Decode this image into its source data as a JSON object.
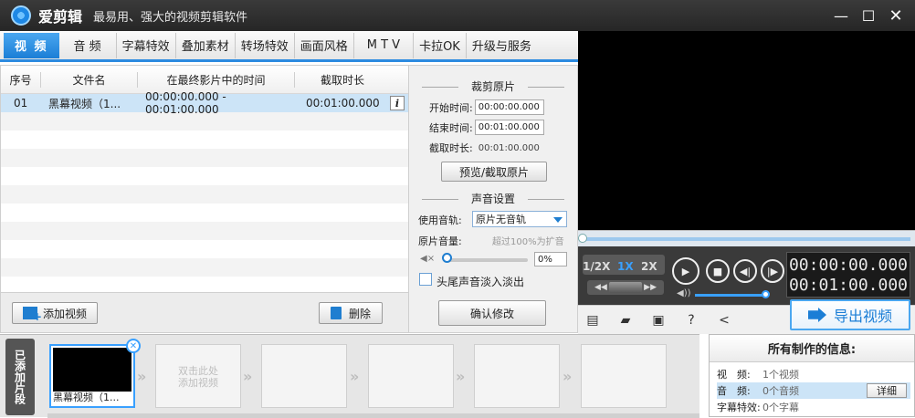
{
  "app": {
    "title": "爱剪辑",
    "subtitle": "最易用、强大的视频剪辑软件"
  },
  "window": {
    "minimize": "—",
    "maximize": "☐",
    "close": "✕"
  },
  "tabs": [
    "视 频",
    "音 频",
    "字幕特效",
    "叠加素材",
    "转场特效",
    "画面风格",
    "M T V",
    "卡拉OK",
    "升级与服务"
  ],
  "video_list": {
    "columns": [
      "序号",
      "文件名",
      "在最终影片中的时间",
      "截取时长"
    ],
    "rows": [
      {
        "index": "01",
        "name": "黑幕视频（1...",
        "timespan": "00:00:00.000 - 00:01:00.000",
        "duration": "00:01:00.000"
      }
    ],
    "add_button": "添加视频",
    "delete_button": "删除"
  },
  "clip": {
    "section_title": "裁剪原片",
    "start_label": "开始时间:",
    "start_value": "00:00:00.000",
    "end_label": "结束时间:",
    "end_value": "00:01:00.000",
    "duration_label": "截取时长:",
    "duration_value": "00:01:00.000",
    "preview_button": "预览/截取原片"
  },
  "sound": {
    "section_title": "声音设置",
    "track_label": "使用音轨:",
    "track_value": "原片无音轨",
    "volume_label": "原片音量:",
    "volume_hint": "超过100%为扩音",
    "volume_value": "0%",
    "fade_label": "头尾声音淡入淡出",
    "confirm_button": "确认修改"
  },
  "player": {
    "speeds": [
      "1/2X",
      "1X",
      "2X"
    ],
    "active_speed": "1X",
    "current_time": "00:00:00.000",
    "total_time": "00:01:00.000"
  },
  "export_button": "导出视频",
  "timeline": {
    "side_label": "已添加片段",
    "first_clip_label": "黑幕视频（1...",
    "hint_line1": "双击此处",
    "hint_line2": "添加视频"
  },
  "info": {
    "title": "所有制作的信息:",
    "rows": [
      {
        "key": "视　频:",
        "value": "1个视频"
      },
      {
        "key": "音　频:",
        "value": "0个音频"
      },
      {
        "key": "字幕特效:",
        "value": "0个字幕"
      }
    ],
    "detail_button": "详细"
  }
}
